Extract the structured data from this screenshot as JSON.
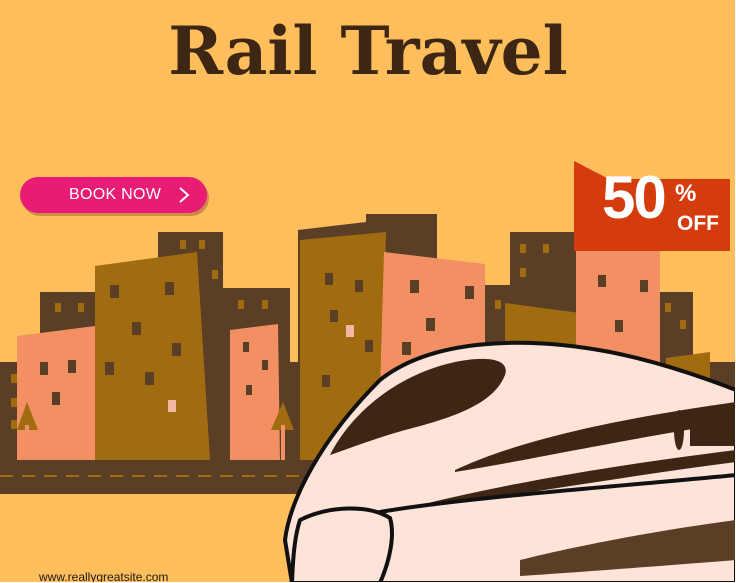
{
  "title": "Rail Travel",
  "cta": {
    "label": "BOOK NOW",
    "icon": "chevron-right-icon"
  },
  "badge": {
    "percent": "50",
    "symbol": "%",
    "off": "OFF"
  },
  "footer": {
    "website": "www.reallygreatsite.com"
  },
  "colors": {
    "background": "#ffbe5c",
    "title": "#3d2613",
    "button": "#e81c74",
    "badge": "#d43c0e",
    "building_dark": "#5a3f26",
    "building_ochre": "#a16b0f",
    "building_salmon": "#f29063",
    "train_body": "#fde3d8"
  }
}
